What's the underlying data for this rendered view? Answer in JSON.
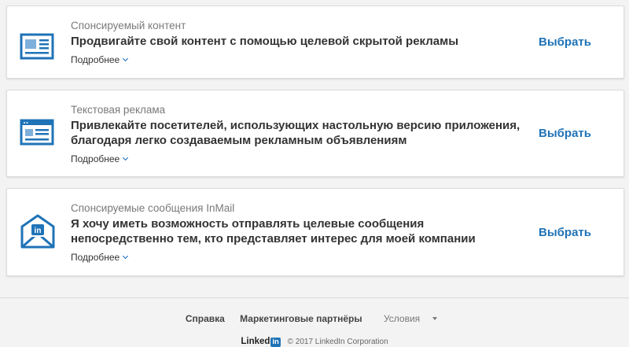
{
  "cards": [
    {
      "type_label": "Спонсируемый контент",
      "headline_lines": [
        "Продвигайте свой контент с помощью целевой скрытой рекламы"
      ],
      "more_label": "Подробнее",
      "select_label": "Выбрать",
      "icon": "newspaper-icon"
    },
    {
      "type_label": "Текстовая реклама",
      "headline_lines": [
        "Привлекайте посетителей, использующих настольную версию приложения,",
        "благодаря легко создаваемым рекламным объявлениям"
      ],
      "more_label": "Подробнее",
      "select_label": "Выбрать",
      "icon": "browser-window-icon"
    },
    {
      "type_label": "Спонсируемые сообщения InMail",
      "headline_lines": [
        "Я хочу иметь возможность отправлять целевые сообщения",
        "непосредственно тем, кто представляет интерес для моей компании"
      ],
      "more_label": "Подробнее",
      "select_label": "Выбрать",
      "icon": "linkedin-envelope-icon"
    }
  ],
  "footer": {
    "links": [
      "Справка",
      "Маркетинговые партнёры",
      "Условия"
    ],
    "logo_text": "Linked",
    "logo_in": "in",
    "copyright": "© 2017 LinkedIn Corporation"
  },
  "colors": {
    "accent": "#1f73b7",
    "background": "#f3f3f3"
  }
}
